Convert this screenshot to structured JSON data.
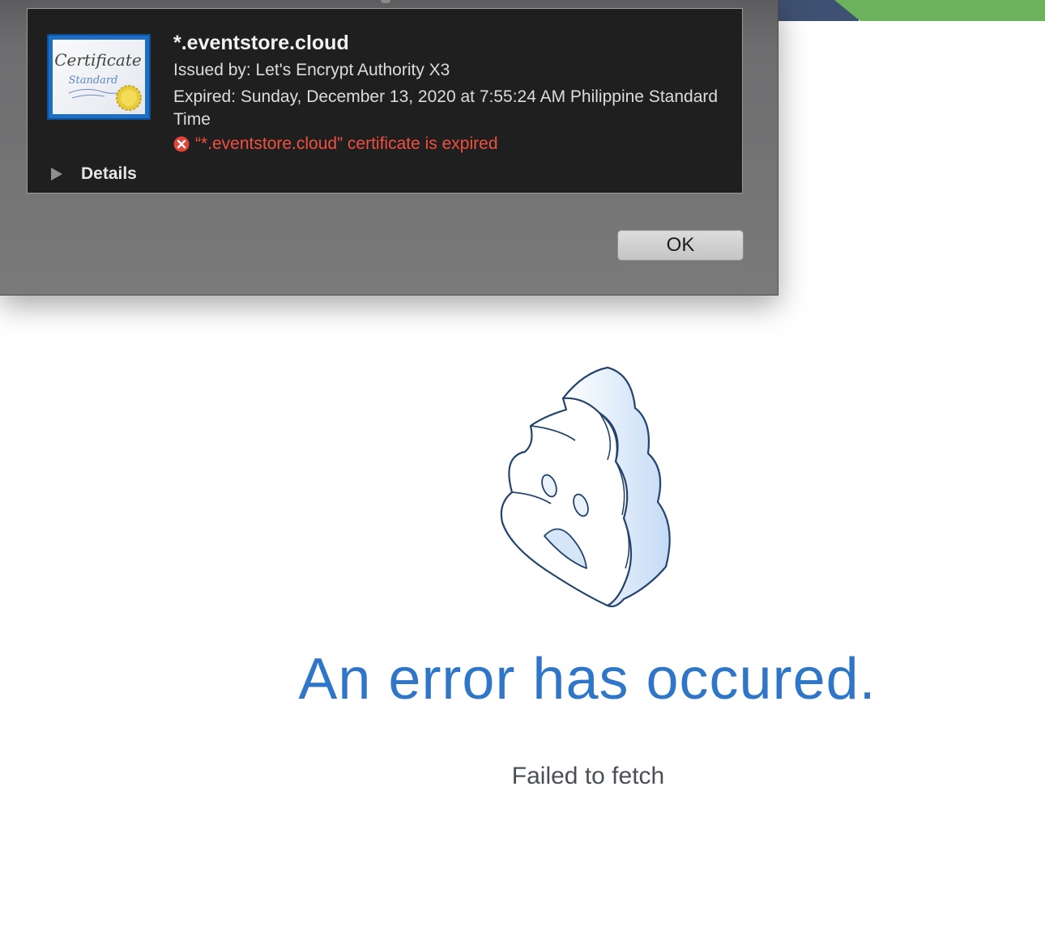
{
  "dialog": {
    "certificate_icon": {
      "title_text": "Certificate",
      "subtitle_text": "Standard"
    },
    "cert_name": "*.eventstore.cloud",
    "issued_by": "Issued by: Let's Encrypt Authority X3",
    "expired": "Expired: Sunday, December 13, 2020 at 7:55:24 AM Philippine Standard Time",
    "error_message": "“*.eventstore.cloud” certificate is expired",
    "details_label": "Details",
    "ok_label": "OK"
  },
  "page": {
    "title": "An error has occured.",
    "message": "Failed to fetch",
    "illustration_icon": "sad-cloud-icon"
  },
  "colors": {
    "error_red": "#f0503f",
    "title_blue": "#2f76c9",
    "banner_navy": "#3f5172",
    "banner_green": "#6cb25c"
  }
}
